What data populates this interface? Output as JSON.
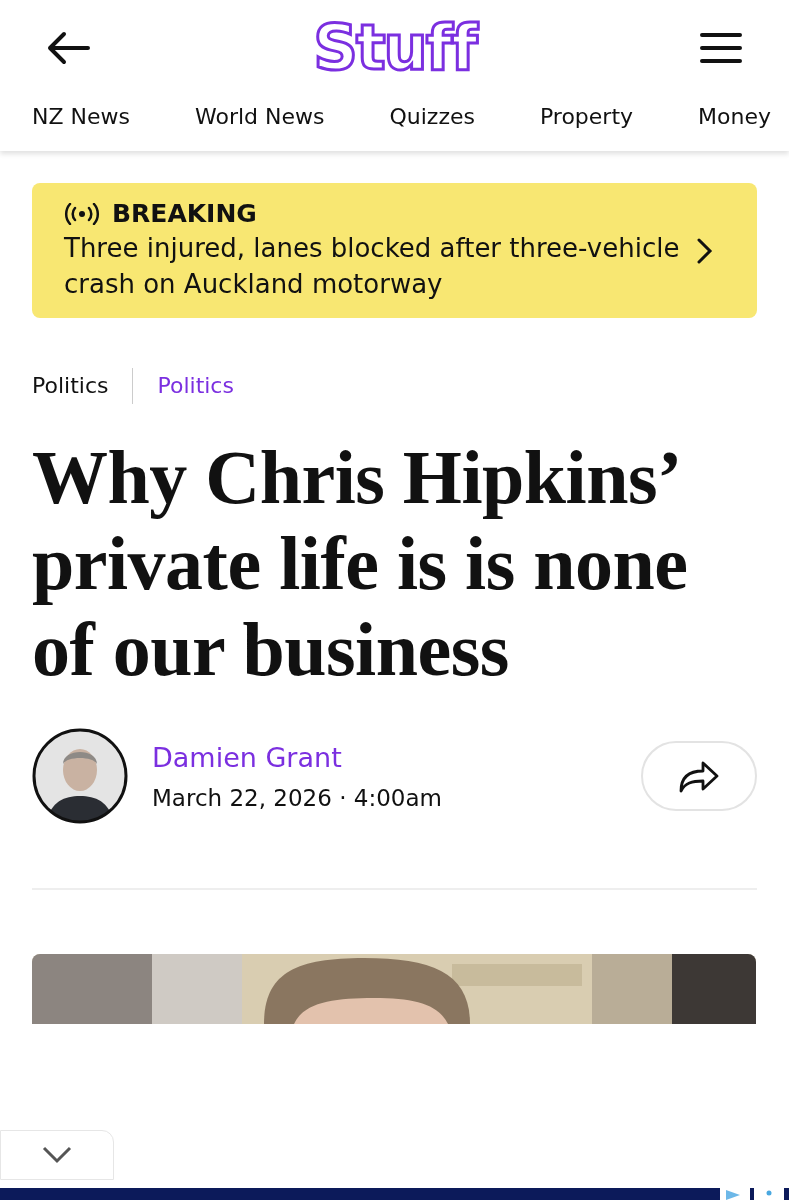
{
  "header": {
    "logo": "Stuff"
  },
  "nav": [
    {
      "label": "NZ News"
    },
    {
      "label": "World News"
    },
    {
      "label": "Quizzes"
    },
    {
      "label": "Property"
    },
    {
      "label": "Money"
    }
  ],
  "breaking": {
    "label": "BREAKING",
    "headline": "Three injured, lanes blocked after three-vehicle crash on Auckland motorway"
  },
  "categories": [
    {
      "label": "Politics",
      "kind": "section"
    },
    {
      "label": "Politics",
      "kind": "topic"
    }
  ],
  "article": {
    "headline": "Why Chris Hipkins’ private life is is none of our business",
    "author": "Damien Grant",
    "date": "March 22, 2026 · 4:00am"
  }
}
